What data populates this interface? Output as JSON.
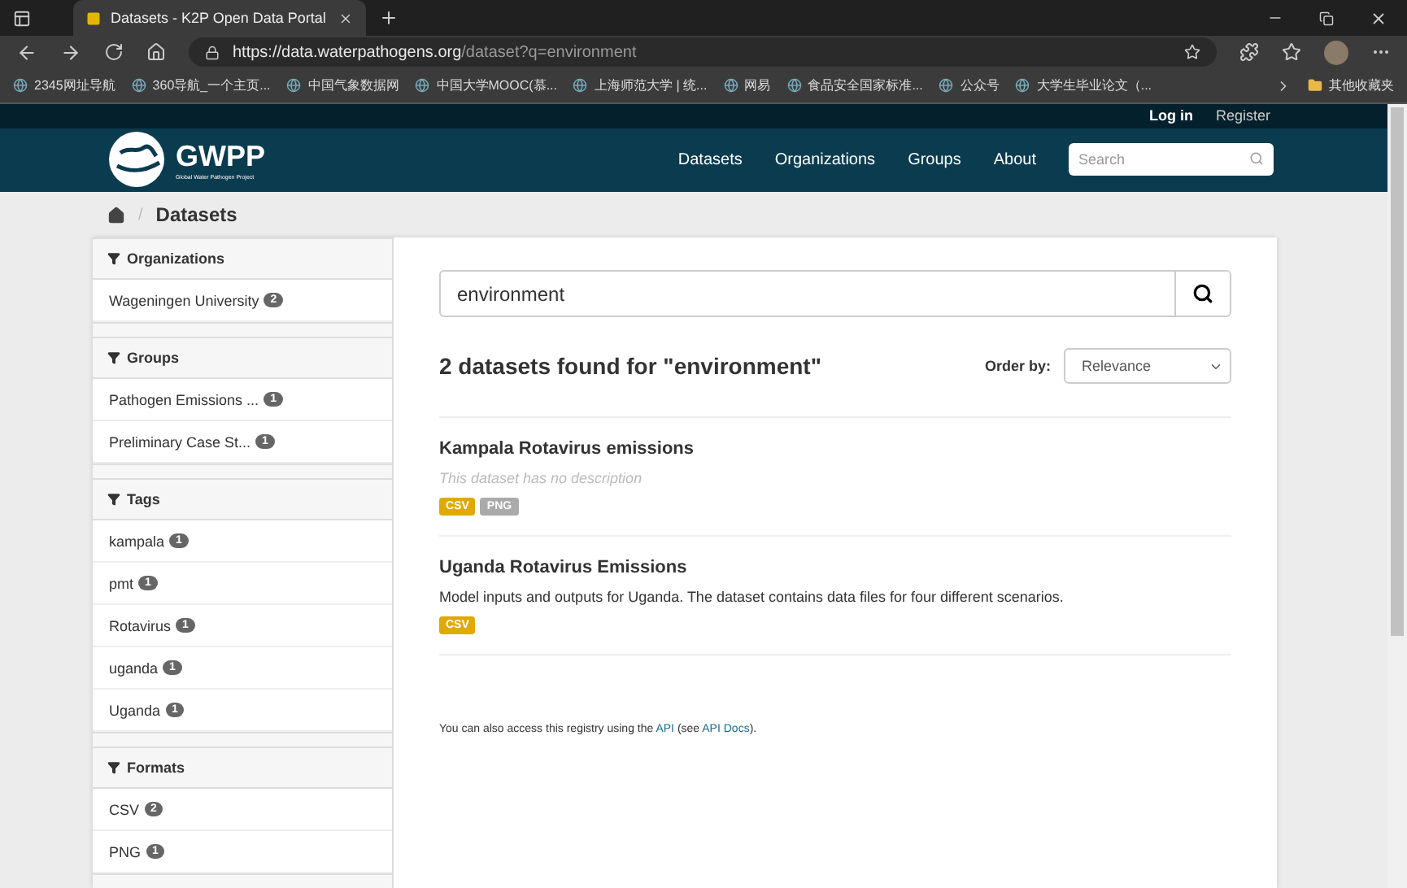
{
  "browser": {
    "tab": {
      "title": "Datasets - K2P Open Data Portal"
    },
    "url": {
      "host": "https://data.waterpathogens.org",
      "path": "/dataset?q=environment"
    },
    "bookmarks": [
      {
        "label": "2345网址导航"
      },
      {
        "label": "360导航_一个主页..."
      },
      {
        "label": "中国气象数据网"
      },
      {
        "label": "中国大学MOOC(慕..."
      },
      {
        "label": "上海师范大学 | 统..."
      },
      {
        "label": "网易"
      },
      {
        "label": "食品安全国家标准..."
      },
      {
        "label": "公众号"
      },
      {
        "label": "大学生毕业论文（..."
      }
    ],
    "other_bookmarks": "其他收藏夹"
  },
  "account": [
    "Log in",
    "Register"
  ],
  "header": {
    "logo": "GWPP",
    "logo_sub": "Global Water Pathogen Project",
    "nav": [
      "Datasets",
      "Organizations",
      "Groups",
      "About"
    ],
    "search": {
      "placeholder": "Search"
    }
  },
  "breadcrumb_separator": "/",
  "breadcrumb": "Datasets",
  "facets": [
    {
      "title": "Organizations",
      "items": [
        {
          "label": "Wageningen University",
          "count": "2"
        }
      ]
    },
    {
      "title": "Groups",
      "items": [
        {
          "label": "Pathogen Emissions ...",
          "count": "1"
        },
        {
          "label": "Preliminary Case St...",
          "count": "1"
        }
      ]
    },
    {
      "title": "Tags",
      "items": [
        {
          "label": "kampala",
          "count": "1"
        },
        {
          "label": "pmt",
          "count": "1"
        },
        {
          "label": "Rotavirus",
          "count": "1"
        },
        {
          "label": "uganda",
          "count": "1"
        },
        {
          "label": "Uganda",
          "count": "1"
        }
      ]
    },
    {
      "title": "Formats",
      "items": [
        {
          "label": "CSV",
          "count": "2"
        },
        {
          "label": "PNG",
          "count": "1"
        }
      ]
    }
  ],
  "query": {
    "value": "environment"
  },
  "results_title": "2 datasets found for \"environment\"",
  "order_by": {
    "label": "Order by:",
    "value": "Relevance"
  },
  "datasets": [
    {
      "title": "Kampala Rotavirus emissions",
      "description": "This dataset has no description",
      "empty_description": true,
      "formats": [
        {
          "label": "CSV",
          "color": "#dfaa00"
        },
        {
          "label": "PNG",
          "color": "#aaaaaa"
        }
      ]
    },
    {
      "title": "Uganda Rotavirus Emissions",
      "description": "Model inputs and outputs for Uganda. The dataset contains data files for four different scenarios.",
      "empty_description": false,
      "formats": [
        {
          "label": "CSV",
          "color": "#dfaa00"
        }
      ]
    }
  ],
  "api_note": {
    "before": "You can also access this registry using the ",
    "link": "API",
    "middle": " (see ",
    "link2": "API Docs",
    "after": ")."
  }
}
